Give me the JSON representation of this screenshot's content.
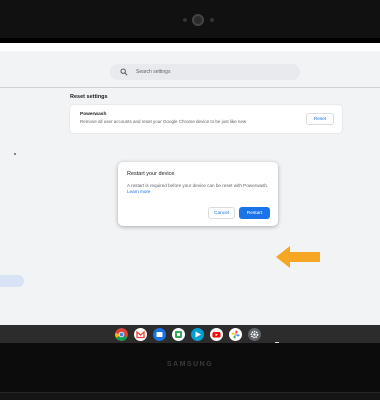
{
  "settings": {
    "search_placeholder": "Search settings",
    "section_title": "Reset settings",
    "powerwash": {
      "title": "Powerwash",
      "description": "Remove all user accounts and reset your Google Chrome device to be just like new",
      "button_label": "Reset"
    }
  },
  "dialog": {
    "title": "Restart your device",
    "body": "A restart is required before your device can be reset with Powerwash.",
    "link_text": "Learn more",
    "cancel_label": "Cancel",
    "restart_label": "Restart"
  },
  "shelf": {
    "apps": [
      {
        "name": "chrome-icon"
      },
      {
        "name": "gmail-icon"
      },
      {
        "name": "files-icon"
      },
      {
        "name": "photos-icon"
      },
      {
        "name": "play-store-icon"
      },
      {
        "name": "youtube-icon"
      },
      {
        "name": "google-photos-icon"
      },
      {
        "name": "settings-icon"
      }
    ]
  },
  "device": {
    "brand": "SAMSUNG"
  },
  "colors": {
    "accent": "#1a73e8",
    "arrow": "#f5a623"
  }
}
